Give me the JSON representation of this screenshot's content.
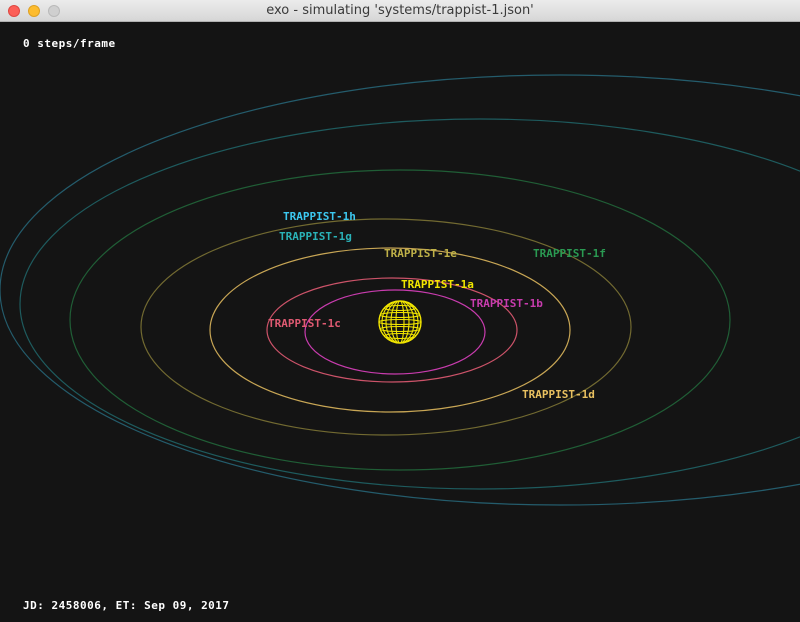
{
  "window": {
    "title": "exo - simulating 'systems/trappist-1.json'",
    "controls": [
      "close",
      "minimize",
      "zoom"
    ]
  },
  "hud": {
    "steps": "0 steps/frame",
    "status": "JD: 2458006, ET: Sep 09, 2017"
  },
  "star": {
    "name": "TRAPPIST-1a",
    "color": "#f2e600"
  },
  "planets": [
    {
      "name": "TRAPPIST-1b",
      "color": "#c83cae"
    },
    {
      "name": "TRAPPIST-1c",
      "color": "#e05a72"
    },
    {
      "name": "TRAPPIST-1d",
      "color": "#e8c060"
    },
    {
      "name": "TRAPPIST-1e",
      "color": "#bfb148"
    },
    {
      "name": "TRAPPIST-1f",
      "color": "#2a9a52"
    },
    {
      "name": "TRAPPIST-1g",
      "color": "#2ab2b8"
    },
    {
      "name": "TRAPPIST-1h",
      "color": "#3cc8f0"
    }
  ]
}
